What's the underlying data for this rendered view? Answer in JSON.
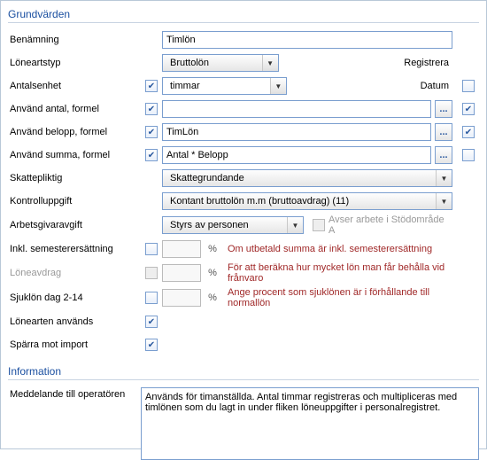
{
  "sections": {
    "grundvarden": "Grundvärden",
    "information": "Information"
  },
  "labels": {
    "benamning": "Benämning",
    "lonartstyp": "Löneartstyp",
    "antalsenhet": "Antalsenhet",
    "anvand_antal": "Använd antal, formel",
    "anvand_belopp": "Använd belopp, formel",
    "anvand_summa": "Använd summa, formel",
    "skattepliktig": "Skattepliktig",
    "kontrolluppgift": "Kontrolluppgift",
    "arbetsgivaravgift": "Arbetsgivaravgift",
    "inkl_sem": "Inkl. semesterersättning",
    "loneavdrag": "Löneavdrag",
    "sjuklon": "Sjuklön dag 2-14",
    "lonearten_anvands": "Lönearten används",
    "sparra_import": "Spärra mot import",
    "meddelande": "Meddelande till operatören",
    "registrera": "Registrera",
    "datum": "Datum",
    "avser": "Avser arbete i Stödområde A"
  },
  "values": {
    "benamning": "Timlön",
    "lonartstyp": "Bruttolön",
    "antalsenhet": "timmar",
    "formel_antal": "",
    "formel_belopp": "TimLön",
    "formel_summa": "Antal * Belopp",
    "skattepliktig": "Skattegrundande",
    "kontrolluppgift": "Kontant bruttolön m.m (bruttoavdrag) (11)",
    "arbetsgivaravgift": "Styrs av personen",
    "meddelande": "Används för timanställda. Antal timmar registreras och multipliceras med timlönen som du lagt in under fliken löneuppgifter i personalregistret."
  },
  "hints": {
    "inkl_sem": "Om utbetald summa är inkl. semesterersättning",
    "loneavdrag": "För att beräkna hur mycket lön man får behålla vid frånvaro",
    "sjuklon": "Ange procent som sjuklönen är i förhållande till normallön"
  },
  "glyph": {
    "percent": "%",
    "ellipsis": "..."
  }
}
